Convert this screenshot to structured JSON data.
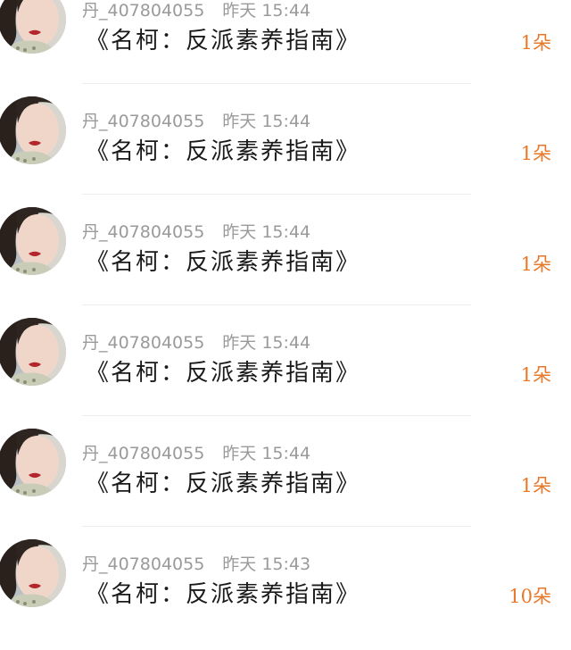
{
  "comments": [
    {
      "username": "丹_407804055",
      "time": "昨天 15:44",
      "text": "《名柯：反派素养指南》",
      "gift": "1朵"
    },
    {
      "username": "丹_407804055",
      "time": "昨天 15:44",
      "text": "《名柯：反派素养指南》",
      "gift": "1朵"
    },
    {
      "username": "丹_407804055",
      "time": "昨天 15:44",
      "text": "《名柯：反派素养指南》",
      "gift": "1朵"
    },
    {
      "username": "丹_407804055",
      "time": "昨天 15:44",
      "text": "《名柯：反派素养指南》",
      "gift": "1朵"
    },
    {
      "username": "丹_407804055",
      "time": "昨天 15:44",
      "text": "《名柯：反派素养指南》",
      "gift": "1朵"
    },
    {
      "username": "丹_407804055",
      "time": "昨天 15:43",
      "text": "《名柯：反派素养指南》",
      "gift": "10朵"
    }
  ],
  "colors": {
    "gift": "#e8782a",
    "meta": "#9a9a9a",
    "text": "#1a1a1a",
    "divider": "#ececec"
  }
}
